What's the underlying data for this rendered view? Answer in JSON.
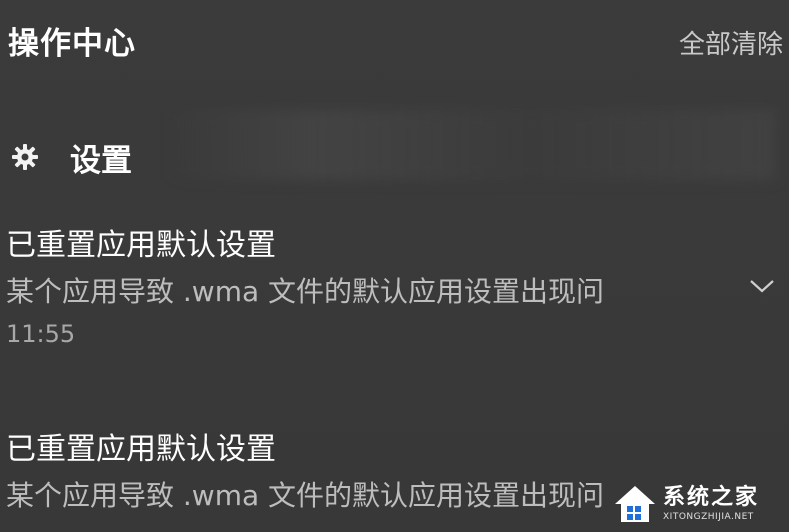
{
  "header": {
    "title": "操作中心",
    "clear_all_label": "全部清除"
  },
  "group": {
    "icon": "gear-icon",
    "label": "设置"
  },
  "notifications": [
    {
      "title": "已重置应用默认设置",
      "body": "某个应用导致 .wma 文件的默认应用设置出现问",
      "time": "11:55"
    },
    {
      "title": "已重置应用默认设置",
      "body": "某个应用导致 .wma 文件的默认应用设置出现问"
    }
  ],
  "watermark": {
    "name": "系统之家",
    "url": "XITONGZHIJIA.NET"
  },
  "colors": {
    "background": "#3a3a3a",
    "title_text": "#ffffff",
    "body_text": "#bdbdbd",
    "secondary_text": "#c9c9c9"
  }
}
